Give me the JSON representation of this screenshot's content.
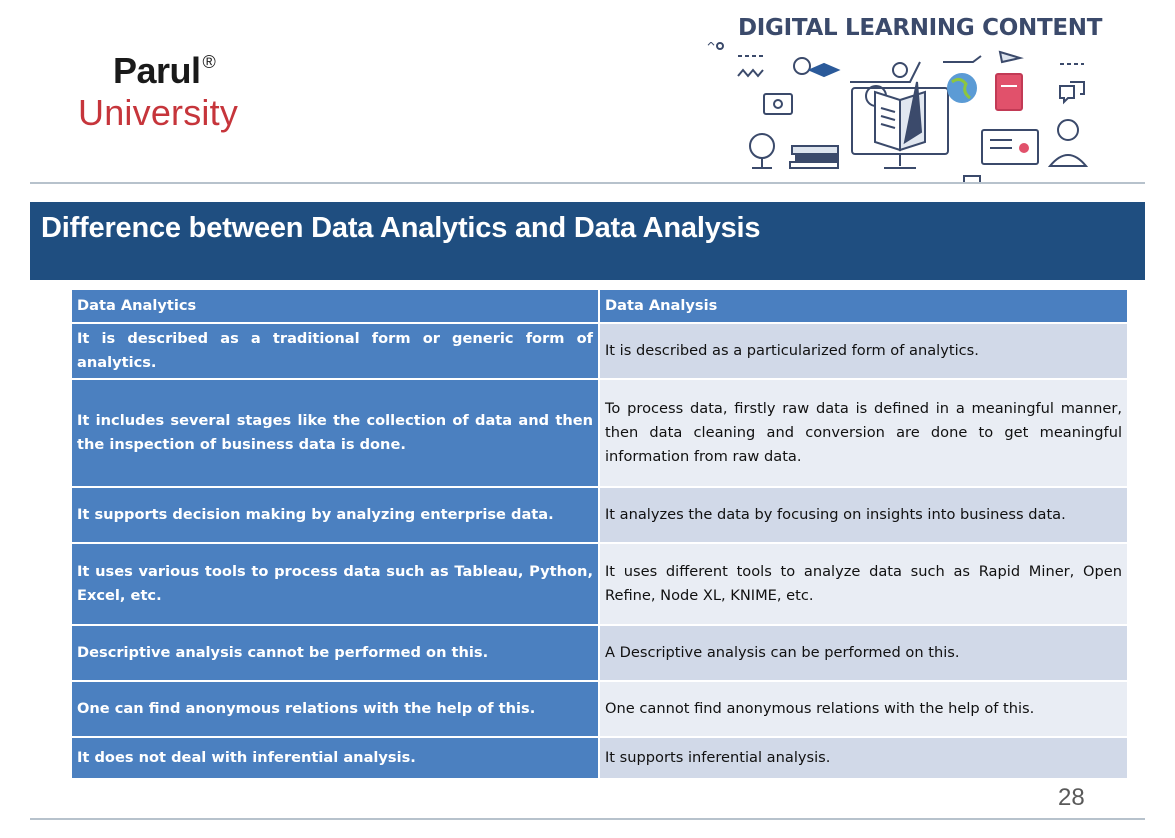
{
  "header": {
    "logo": {
      "name": "Parul",
      "reg_mark": "®",
      "sub": "University"
    },
    "dlc_title": "DIGITAL LEARNING CONTENT"
  },
  "slide": {
    "title": "Difference between Data Analytics and Data Analysis",
    "table": {
      "headers": [
        "Data Analytics",
        "Data Analysis"
      ],
      "rows": [
        [
          "It is described as a traditional form or generic form of analytics.",
          "It is described as a particularized form of analytics."
        ],
        [
          "It includes several stages like the collection of data and then the inspection of business data is done.",
          "To process data, firstly raw data is defined in a meaningful manner, then data cleaning and conversion are done to get meaningful information from raw data."
        ],
        [
          "It supports decision making by analyzing enterprise data.",
          "It analyzes the data by focusing on insights into business data."
        ],
        [
          "It uses various tools to process data such as Tableau, Python, Excel, etc.",
          "It uses different tools to analyze data such as Rapid Miner, Open Refine, Node XL, KNIME, etc."
        ],
        [
          "Descriptive analysis cannot be performed on this.",
          "A Descriptive analysis can be performed on this."
        ],
        [
          "One can find anonymous relations with the help of this.",
          "One cannot find anonymous relations with the help of this."
        ],
        [
          "It does not deal with inferential analysis.",
          "It supports inferential analysis."
        ]
      ]
    },
    "page_number": "28"
  },
  "colors": {
    "banner": "#1f4e80",
    "header_cell": "#4a7fc0",
    "left_cell": "#4b80c0",
    "right_cell_odd": "#d1d9e8",
    "right_cell_even": "#e9edf4",
    "logo_red": "#c6353b",
    "dlc_title": "#3b4a6b"
  },
  "icons": [
    "education-illustration-icon"
  ]
}
